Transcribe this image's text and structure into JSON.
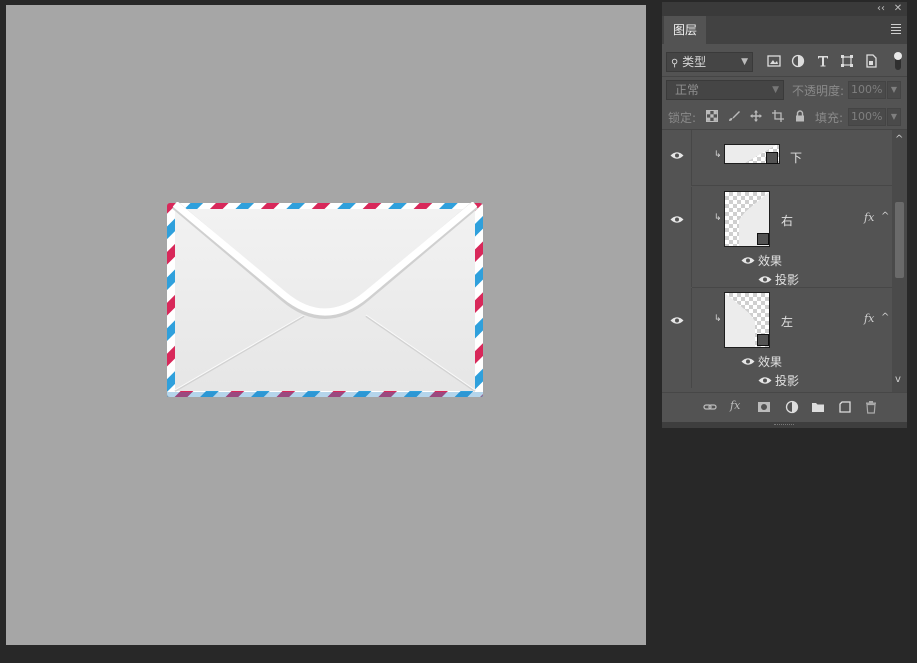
{
  "panel": {
    "tab_title": "图层",
    "collapse_glyph": "‹‹",
    "close_glyph": "✕",
    "filter_kind": "类型",
    "blend_mode": "正常",
    "opacity_label": "不透明度:",
    "opacity_value": "100%",
    "lock_label": "锁定:",
    "fill_label": "填充:",
    "fill_value": "100%"
  },
  "layers": [
    {
      "name": "下",
      "visible": true,
      "clipped": true
    },
    {
      "name": "右",
      "visible": true,
      "clipped": true,
      "fx": "fx",
      "effects_label": "效果",
      "effects": [
        "投影"
      ]
    },
    {
      "name": "左",
      "visible": true,
      "clipped": true,
      "fx": "fx",
      "effects_label": "效果",
      "effects": [
        "投影"
      ]
    }
  ],
  "icons": {
    "filter_icons": [
      "image-filter-icon",
      "adjustment-filter-icon",
      "type-filter-icon",
      "shape-filter-icon",
      "smart-object-filter-icon"
    ],
    "lock_icons": [
      "lock-transparent-icon",
      "lock-image-icon",
      "lock-position-icon",
      "lock-artboard-icon",
      "lock-all-icon"
    ],
    "footer_icons": [
      "link-layers-icon",
      "fx-icon",
      "mask-icon",
      "new-adjustment-icon",
      "new-group-icon",
      "new-layer-icon",
      "trash-icon"
    ]
  },
  "colors": {
    "canvas_bg": "#a6a6a6",
    "panel_bg": "#535353",
    "envelope_paper": "#ededed",
    "stripe_red": "#d8285a",
    "stripe_blue": "#2fa0dc"
  }
}
